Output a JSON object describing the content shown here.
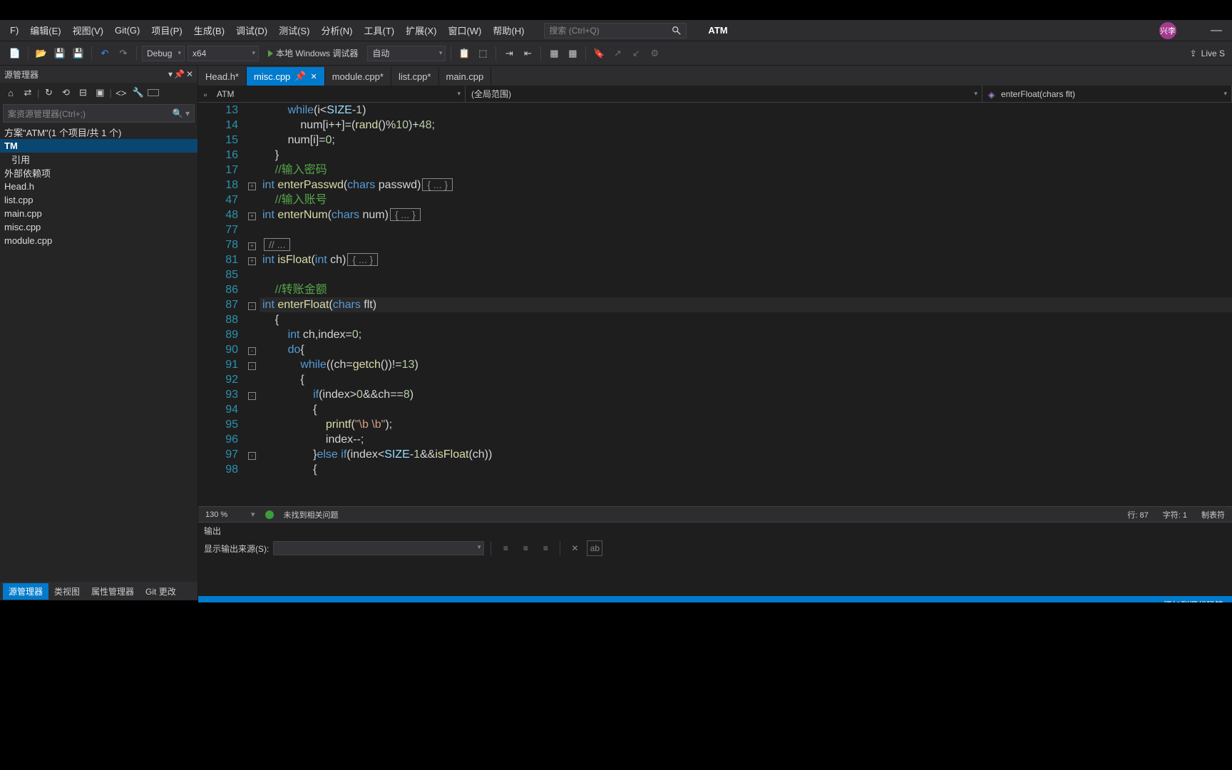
{
  "menu": {
    "items": [
      "F)",
      "编辑(E)",
      "视图(V)",
      "Git(G)",
      "项目(P)",
      "生成(B)",
      "调试(D)",
      "测试(S)",
      "分析(N)",
      "工具(T)",
      "扩展(X)",
      "窗口(W)",
      "帮助(H)"
    ],
    "search_placeholder": "搜索 (Ctrl+Q)",
    "project": "ATM",
    "user_initials": "兴李"
  },
  "toolbar": {
    "config": "Debug",
    "platform": "x64",
    "debug_target": "本地 Windows 调试器",
    "auto": "自动",
    "live_share": "Live S"
  },
  "explorer": {
    "title": "源管理器",
    "search_placeholder": "案资源管理器(Ctrl+;)",
    "solution": "方案\"ATM\"(1 个项目/共 1 个)",
    "project": "TM",
    "nodes": [
      "引用",
      "外部依赖项",
      "Head.h",
      "list.cpp",
      "main.cpp",
      "misc.cpp",
      "module.cpp"
    ]
  },
  "tabs": [
    {
      "label": "Head.h*",
      "active": false,
      "close": false
    },
    {
      "label": "misc.cpp",
      "active": true,
      "close": true,
      "pin": true
    },
    {
      "label": "module.cpp*",
      "active": false,
      "close": false
    },
    {
      "label": "list.cpp*",
      "active": false,
      "close": false
    },
    {
      "label": "main.cpp",
      "active": false,
      "close": false
    }
  ],
  "navbar": {
    "project": "ATM",
    "scope": "(全局范围)",
    "member": "enterFloat(chars flt)"
  },
  "code": {
    "lines": [
      {
        "n": 13,
        "fold": "",
        "segs": [
          {
            "t": "        "
          },
          {
            "t": "while",
            "c": "kw"
          },
          {
            "t": "(i<"
          },
          {
            "t": "SIZE",
            "c": "var"
          },
          {
            "t": "-"
          },
          {
            "t": "1",
            "c": "num-lit"
          },
          {
            "t": ")"
          }
        ]
      },
      {
        "n": 14,
        "fold": "",
        "segs": [
          {
            "t": "            num[i++]=("
          },
          {
            "t": "rand",
            "c": "fn"
          },
          {
            "t": "()%"
          },
          {
            "t": "10",
            "c": "num-lit"
          },
          {
            "t": ")+"
          },
          {
            "t": "48",
            "c": "num-lit"
          },
          {
            "t": ";"
          }
        ]
      },
      {
        "n": 15,
        "fold": "",
        "segs": [
          {
            "t": "        num[i]="
          },
          {
            "t": "0",
            "c": "num-lit"
          },
          {
            "t": ";"
          }
        ]
      },
      {
        "n": 16,
        "fold": "",
        "segs": [
          {
            "t": "    }"
          }
        ]
      },
      {
        "n": 17,
        "fold": "",
        "segs": [
          {
            "t": "    "
          },
          {
            "t": "//输入密码",
            "c": "cm"
          }
        ]
      },
      {
        "n": 18,
        "fold": "+",
        "segs": [
          {
            "t": "int ",
            "c": "ty"
          },
          {
            "t": "enterPasswd",
            "c": "fn"
          },
          {
            "t": "("
          },
          {
            "t": "chars",
            "c": "ty"
          },
          {
            "t": " passwd)"
          }
        ],
        "box": "{ ... }"
      },
      {
        "n": 47,
        "fold": "",
        "segs": [
          {
            "t": "    "
          },
          {
            "t": "//输入账号",
            "c": "cm"
          }
        ]
      },
      {
        "n": 48,
        "fold": "+",
        "segs": [
          {
            "t": "int ",
            "c": "ty"
          },
          {
            "t": "enterNum",
            "c": "fn"
          },
          {
            "t": "("
          },
          {
            "t": "chars",
            "c": "ty"
          },
          {
            "t": " num)"
          }
        ],
        "box": "{ ... }"
      },
      {
        "n": 77,
        "fold": "",
        "segs": [
          {
            "t": ""
          }
        ]
      },
      {
        "n": 78,
        "fold": "+",
        "segs": [
          {
            "t": ""
          }
        ],
        "box": "// ..."
      },
      {
        "n": 81,
        "fold": "+",
        "segs": [
          {
            "t": "int ",
            "c": "ty"
          },
          {
            "t": "isFloat",
            "c": "fn"
          },
          {
            "t": "("
          },
          {
            "t": "int ",
            "c": "ty"
          },
          {
            "t": "ch)"
          }
        ],
        "box": "{ ... }"
      },
      {
        "n": 85,
        "fold": "",
        "segs": [
          {
            "t": ""
          }
        ]
      },
      {
        "n": 86,
        "fold": "",
        "segs": [
          {
            "t": "    "
          },
          {
            "t": "//转账金额",
            "c": "cm"
          }
        ]
      },
      {
        "n": 87,
        "fold": "-",
        "hl": true,
        "segs": [
          {
            "t": "int ",
            "c": "ty"
          },
          {
            "t": "enterFloat",
            "c": "fn"
          },
          {
            "t": "("
          },
          {
            "t": "chars",
            "c": "ty"
          },
          {
            "t": " flt)"
          }
        ]
      },
      {
        "n": 88,
        "fold": "",
        "segs": [
          {
            "t": "    {"
          }
        ]
      },
      {
        "n": 89,
        "fold": "",
        "segs": [
          {
            "t": "        "
          },
          {
            "t": "int ",
            "c": "ty"
          },
          {
            "t": "ch,index="
          },
          {
            "t": "0",
            "c": "num-lit"
          },
          {
            "t": ";"
          }
        ]
      },
      {
        "n": 90,
        "fold": "-",
        "segs": [
          {
            "t": "        "
          },
          {
            "t": "do",
            "c": "kw"
          },
          {
            "t": "{"
          }
        ]
      },
      {
        "n": 91,
        "fold": "-",
        "segs": [
          {
            "t": "            "
          },
          {
            "t": "while",
            "c": "kw"
          },
          {
            "t": "((ch="
          },
          {
            "t": "getch",
            "c": "fn"
          },
          {
            "t": "())!="
          },
          {
            "t": "13",
            "c": "num-lit"
          },
          {
            "t": ")"
          }
        ]
      },
      {
        "n": 92,
        "fold": "",
        "segs": [
          {
            "t": "            {"
          }
        ]
      },
      {
        "n": 93,
        "fold": "-",
        "segs": [
          {
            "t": "                "
          },
          {
            "t": "if",
            "c": "kw"
          },
          {
            "t": "(index>"
          },
          {
            "t": "0",
            "c": "num-lit"
          },
          {
            "t": "&&ch=="
          },
          {
            "t": "8",
            "c": "num-lit"
          },
          {
            "t": ")"
          }
        ]
      },
      {
        "n": 94,
        "fold": "",
        "segs": [
          {
            "t": "                {"
          }
        ]
      },
      {
        "n": 95,
        "fold": "",
        "segs": [
          {
            "t": "                    "
          },
          {
            "t": "printf",
            "c": "fn"
          },
          {
            "t": "("
          },
          {
            "t": "\"\\b \\b\"",
            "c": "str"
          },
          {
            "t": ");"
          }
        ]
      },
      {
        "n": 96,
        "fold": "",
        "segs": [
          {
            "t": "                    index--;"
          }
        ]
      },
      {
        "n": 97,
        "fold": "-",
        "segs": [
          {
            "t": "                }"
          },
          {
            "t": "else if",
            "c": "kw"
          },
          {
            "t": "(index<"
          },
          {
            "t": "SIZE",
            "c": "var"
          },
          {
            "t": "-"
          },
          {
            "t": "1",
            "c": "num-lit"
          },
          {
            "t": "&&"
          },
          {
            "t": "isFloat",
            "c": "fn"
          },
          {
            "t": "(ch))"
          }
        ]
      },
      {
        "n": 98,
        "fold": "",
        "segs": [
          {
            "t": "                {"
          }
        ]
      }
    ]
  },
  "status": {
    "zoom": "130 %",
    "issues": "未找到相关问题",
    "line": "行: 87",
    "col": "字符: 1",
    "tabs": "制表符"
  },
  "output": {
    "title": "输出",
    "source_label": "显示输出来源(S):"
  },
  "bottom_tabs": {
    "items": [
      "源管理器",
      "类视图",
      "属性管理器",
      "Git 更改"
    ],
    "source_control": "添加到源代码管"
  }
}
